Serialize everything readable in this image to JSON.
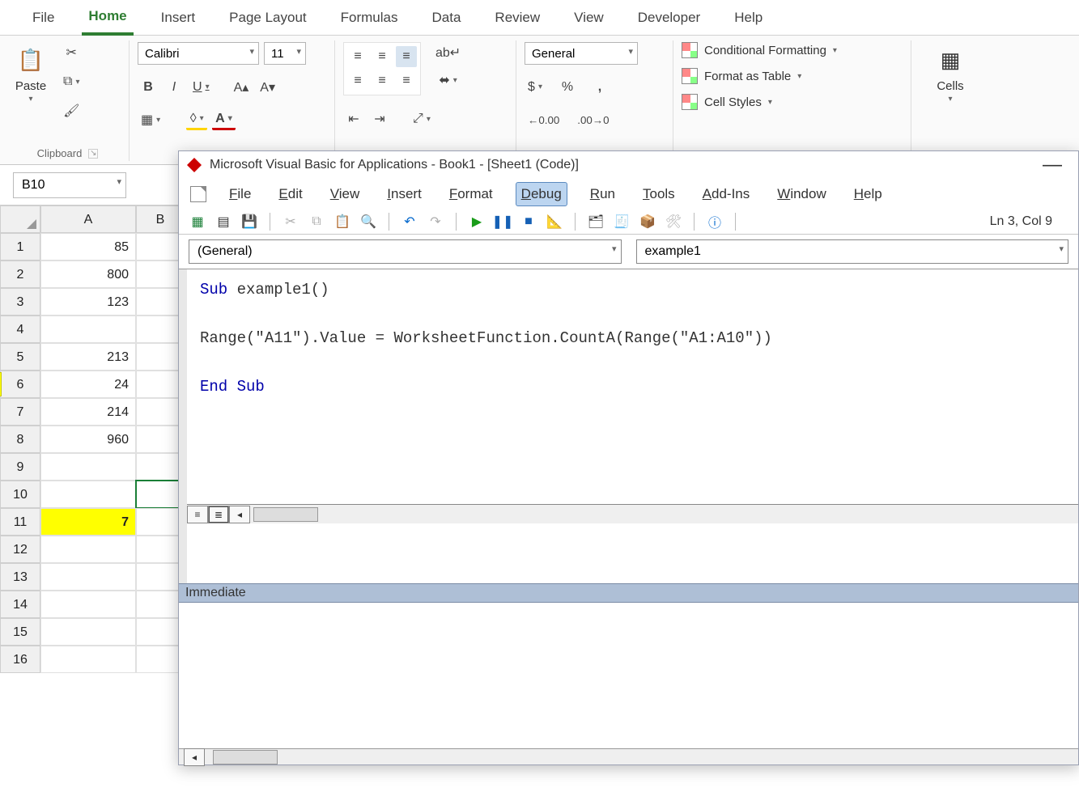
{
  "ribbon_tabs": [
    "File",
    "Home",
    "Insert",
    "Page Layout",
    "Formulas",
    "Data",
    "Review",
    "View",
    "Developer",
    "Help"
  ],
  "ribbon_active": "Home",
  "clipboard": {
    "label": "Clipboard",
    "paste": "Paste"
  },
  "font": {
    "name": "Calibri",
    "size": "11",
    "bold": "B",
    "italic": "I",
    "underline": "U"
  },
  "number": {
    "format": "General",
    "currency": "$",
    "percent": "%",
    "comma": ","
  },
  "styles": {
    "cond": "Conditional Formatting",
    "table": "Format as Table",
    "cell": "Cell Styles"
  },
  "cells": {
    "label": "Cells"
  },
  "namebox": "B10",
  "col_headers": [
    "A",
    "B"
  ],
  "rows": [
    {
      "n": 1,
      "a": "85",
      "b": ""
    },
    {
      "n": 2,
      "a": "800",
      "b": ""
    },
    {
      "n": 3,
      "a": "123",
      "b": ""
    },
    {
      "n": 4,
      "a": "",
      "b": ""
    },
    {
      "n": 5,
      "a": "213",
      "b": ""
    },
    {
      "n": 6,
      "a": "24",
      "b": ""
    },
    {
      "n": 7,
      "a": "214",
      "b": ""
    },
    {
      "n": 8,
      "a": "960",
      "b": ""
    },
    {
      "n": 9,
      "a": "",
      "b": ""
    },
    {
      "n": 10,
      "a": "",
      "b": ""
    },
    {
      "n": 11,
      "a": "7",
      "b": ""
    },
    {
      "n": 12,
      "a": "",
      "b": ""
    },
    {
      "n": 13,
      "a": "",
      "b": ""
    },
    {
      "n": 14,
      "a": "",
      "b": ""
    },
    {
      "n": 15,
      "a": "",
      "b": ""
    },
    {
      "n": 16,
      "a": "",
      "b": ""
    }
  ],
  "highlight_row": 11,
  "selected_cell": "B10",
  "vbe": {
    "title": "Microsoft Visual Basic for Applications - Book1 - [Sheet1 (Code)]",
    "menu": [
      "File",
      "Edit",
      "View",
      "Insert",
      "Format",
      "Debug",
      "Run",
      "Tools",
      "Add-Ins",
      "Window",
      "Help"
    ],
    "menu_active": "Debug",
    "status": "Ln 3, Col 9",
    "object_dd": "(General)",
    "proc_dd": "example1",
    "code": [
      {
        "t": "Sub ",
        "k": true
      },
      {
        "t": "example1()\n\n",
        "k": false
      },
      {
        "t": "Range(\"A11\").Value = WorksheetFunction.CountA(Range(\"A1:A10\"))\n\n",
        "k": false
      },
      {
        "t": "End Sub",
        "k": true
      }
    ],
    "immediate": "Immediate"
  }
}
